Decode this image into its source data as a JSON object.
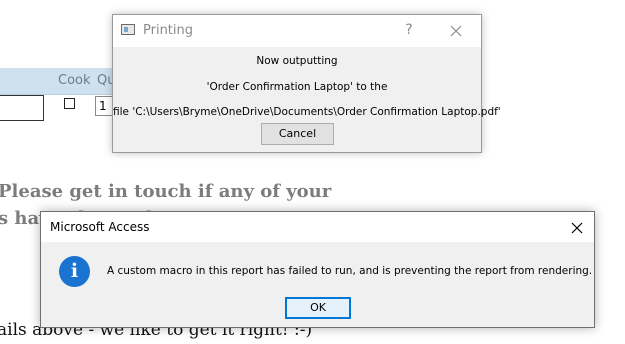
{
  "background_report": {
    "columns": [
      "Cook",
      "Qu"
    ],
    "quantity_value": "1",
    "note_line1": "Please get in touch if any of your",
    "note_line2": "s have changed",
    "note_line3": "ails above - we like to get it right! :-)"
  },
  "printing_dialog": {
    "title": "Printing",
    "help_label": "?",
    "line1": "Now outputting",
    "line2": "'Order Confirmation Laptop' to the",
    "line3": "file 'C:\\Users\\Bryme\\OneDrive\\Documents\\Order Confirmation Laptop.pdf'",
    "cancel_label": "Cancel"
  },
  "message_box": {
    "title": "Microsoft Access",
    "icon": "information-icon",
    "icon_glyph": "i",
    "message": "A custom macro in this report has failed to run, and is preventing the report from rendering.",
    "ok_label": "OK",
    "accent_color": "#0078d7"
  }
}
